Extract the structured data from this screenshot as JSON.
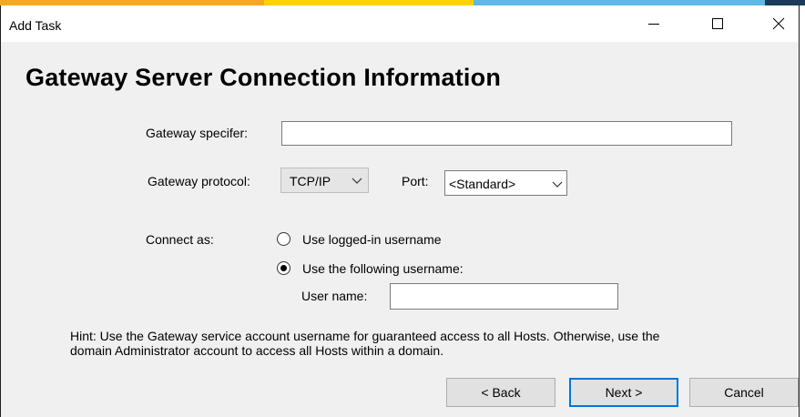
{
  "window": {
    "title": "Add Task"
  },
  "page": {
    "heading": "Gateway Server Connection Information"
  },
  "form": {
    "gateway_specifier_label": "Gateway specifer:",
    "gateway_specifier_value": "",
    "gateway_protocol_label": "Gateway protocol:",
    "gateway_protocol_value": "TCP/IP",
    "port_label": "Port:",
    "port_value": "<Standard>",
    "connect_as_label": "Connect as:",
    "radio_logged_in_label": "Use logged-in username",
    "radio_following_label": "Use the following username:",
    "selected_option": "following",
    "username_label": "User name:",
    "username_value": ""
  },
  "hint": {
    "line1": "Hint: Use the Gateway service account username for guaranteed access to all Hosts. Otherwise, use the",
    "line2": "domain Administrator account to access all Hosts within a domain."
  },
  "buttons": {
    "back": "< Back",
    "next": "Next >",
    "cancel": "Cancel"
  },
  "colors": {
    "accent": "#0078d7",
    "window_bg": "#f0f0f0",
    "titlebar_bg": "#ffffff"
  },
  "icons": [
    "minimize-icon",
    "maximize-icon",
    "close-icon",
    "chevron-down-icon"
  ]
}
